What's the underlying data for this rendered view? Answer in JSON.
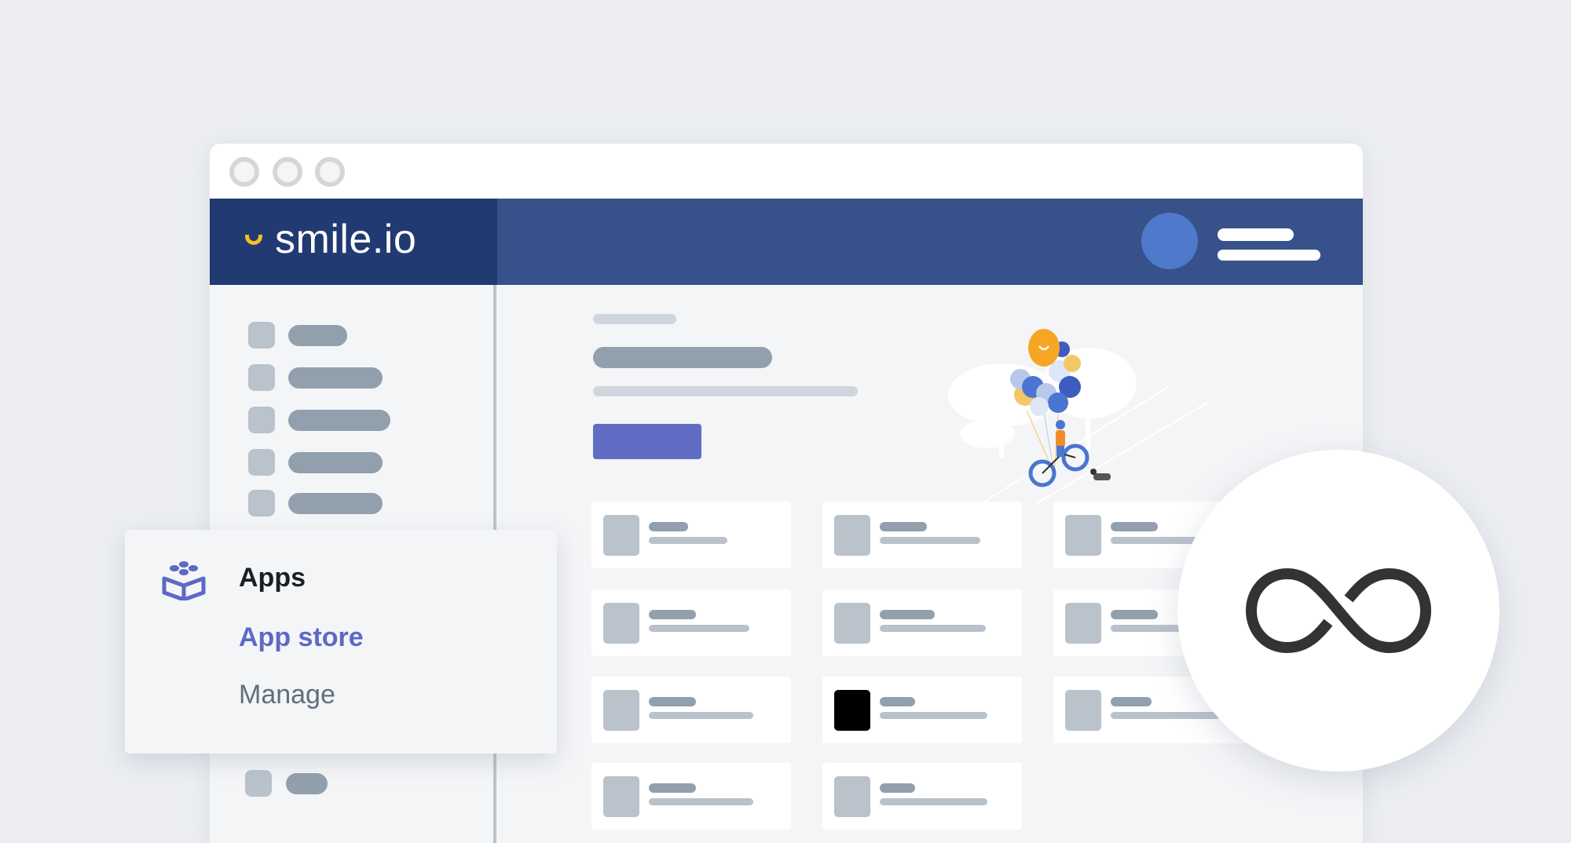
{
  "window": {
    "traffic_lights": [
      "close",
      "minimize",
      "maximize"
    ]
  },
  "header": {
    "brand_name": "smile.io",
    "brand_icon": "smile-icon",
    "brand_color": "#f6bf26",
    "bar_color": "#37528b",
    "brand_bg_color": "#213a72",
    "avatar_color": "#4f79cb"
  },
  "sidebar": {
    "items_top": [
      {
        "icon": "placeholder-icon",
        "label": ""
      },
      {
        "icon": "placeholder-icon",
        "label": ""
      },
      {
        "icon": "placeholder-icon",
        "label": ""
      },
      {
        "icon": "placeholder-icon",
        "label": ""
      },
      {
        "icon": "placeholder-icon",
        "label": ""
      }
    ],
    "items_bottom": [
      {
        "icon": "placeholder-icon",
        "label": ""
      }
    ]
  },
  "menu_popup": {
    "icon": "apps-box-icon",
    "title": "Apps",
    "items": [
      {
        "label": "App store",
        "active": true
      },
      {
        "label": "Manage",
        "active": false
      }
    ],
    "accent_color": "#5c69c5"
  },
  "main": {
    "cta_color": "#616dc4",
    "hero_illustration": "balloons-bicycle-illustration",
    "cards": [
      {
        "thumb": "placeholder"
      },
      {
        "thumb": "placeholder"
      },
      {
        "thumb": "placeholder"
      },
      {
        "thumb": "placeholder"
      },
      {
        "thumb": "placeholder"
      },
      {
        "thumb": "placeholder"
      },
      {
        "thumb": "placeholder"
      },
      {
        "thumb": "dark"
      },
      {
        "thumb": "placeholder"
      },
      {
        "thumb": "placeholder"
      },
      {
        "thumb": "placeholder"
      }
    ]
  },
  "integration_badge": {
    "icon": "infinity-icon",
    "icon_color": "#333333"
  }
}
